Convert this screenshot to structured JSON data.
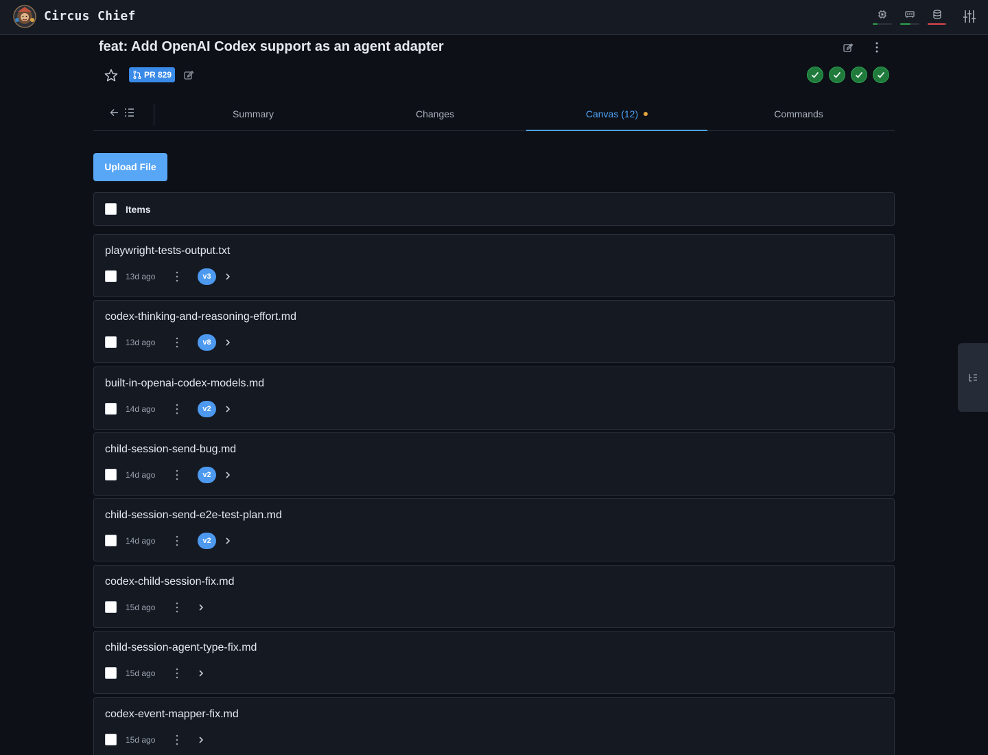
{
  "app": {
    "name": "Circus Chief",
    "status": [
      {
        "icon": "cpu-icon",
        "level": 0.25,
        "color": "#2ea44f"
      },
      {
        "icon": "memory-icon",
        "level": 0.55,
        "color": "#2ea44f"
      },
      {
        "icon": "database-icon",
        "level": 0.9,
        "color": "#e5484d"
      }
    ]
  },
  "pr": {
    "title": "feat: Add OpenAI Codex support as an agent adapter",
    "badge": "PR 829",
    "checks_passed": 4
  },
  "tabs": [
    {
      "label": "Summary",
      "active": false
    },
    {
      "label": "Changes",
      "active": false
    },
    {
      "label": "Canvas (12)",
      "active": true,
      "dot": true
    },
    {
      "label": "Commands",
      "active": false
    }
  ],
  "toolbar": {
    "upload_label": "Upload File"
  },
  "list": {
    "header_label": "Items",
    "items": [
      {
        "name": "playwright-tests-output.txt",
        "age": "13d ago",
        "version": "v3"
      },
      {
        "name": "codex-thinking-and-reasoning-effort.md",
        "age": "13d ago",
        "version": "v8"
      },
      {
        "name": "built-in-openai-codex-models.md",
        "age": "14d ago",
        "version": "v2"
      },
      {
        "name": "child-session-send-bug.md",
        "age": "14d ago",
        "version": "v2"
      },
      {
        "name": "child-session-send-e2e-test-plan.md",
        "age": "14d ago",
        "version": "v2"
      },
      {
        "name": "codex-child-session-fix.md",
        "age": "15d ago",
        "version": ""
      },
      {
        "name": "child-session-agent-type-fix.md",
        "age": "15d ago",
        "version": ""
      },
      {
        "name": "codex-event-mapper-fix.md",
        "age": "15d ago",
        "version": ""
      }
    ]
  },
  "colors": {
    "accent": "#4fa3f7",
    "success": "#2ea44f",
    "background": "#0d1017"
  }
}
